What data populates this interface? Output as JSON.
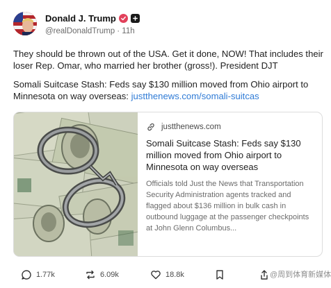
{
  "author": {
    "display_name": "Donald J. Trump",
    "handle_time": "@realDonaldTrump · 11h",
    "verified_icon": "verified-badge-icon",
    "plus_icon": "plus-badge-icon"
  },
  "post": {
    "paragraph_1": "They should be thrown out of the USA. Get it done, NOW! That includes their loser Rep. Omar, who married her brother (gross!). President DJT",
    "paragraph_2_text": "Somali Suitcase Stash: Feds say $130 million moved from Ohio airport to Minnesota on way overseas: ",
    "paragraph_2_link": "justthenews.com/somali-suitcas"
  },
  "link_card": {
    "domain": "justthenews.com",
    "title": "Somali Suitcase Stash: Feds say $130 million moved from Ohio airport to Minnesota on way overseas",
    "description": "Officials told Just the News that Transportation Security Administration agents tracked and flagged about $136 million in bulk cash in outbound luggage at the passenger checkpoints at John Glenn Columbus..."
  },
  "actions": {
    "replies": "1.77k",
    "retruths": "6.09k",
    "likes": "18.8k"
  },
  "watermark": "@周到体育新媒体",
  "colors": {
    "link": "#2f7bd6",
    "verified": "#e2415b",
    "text": "#1f1f1f",
    "muted": "#6b6b6b"
  }
}
